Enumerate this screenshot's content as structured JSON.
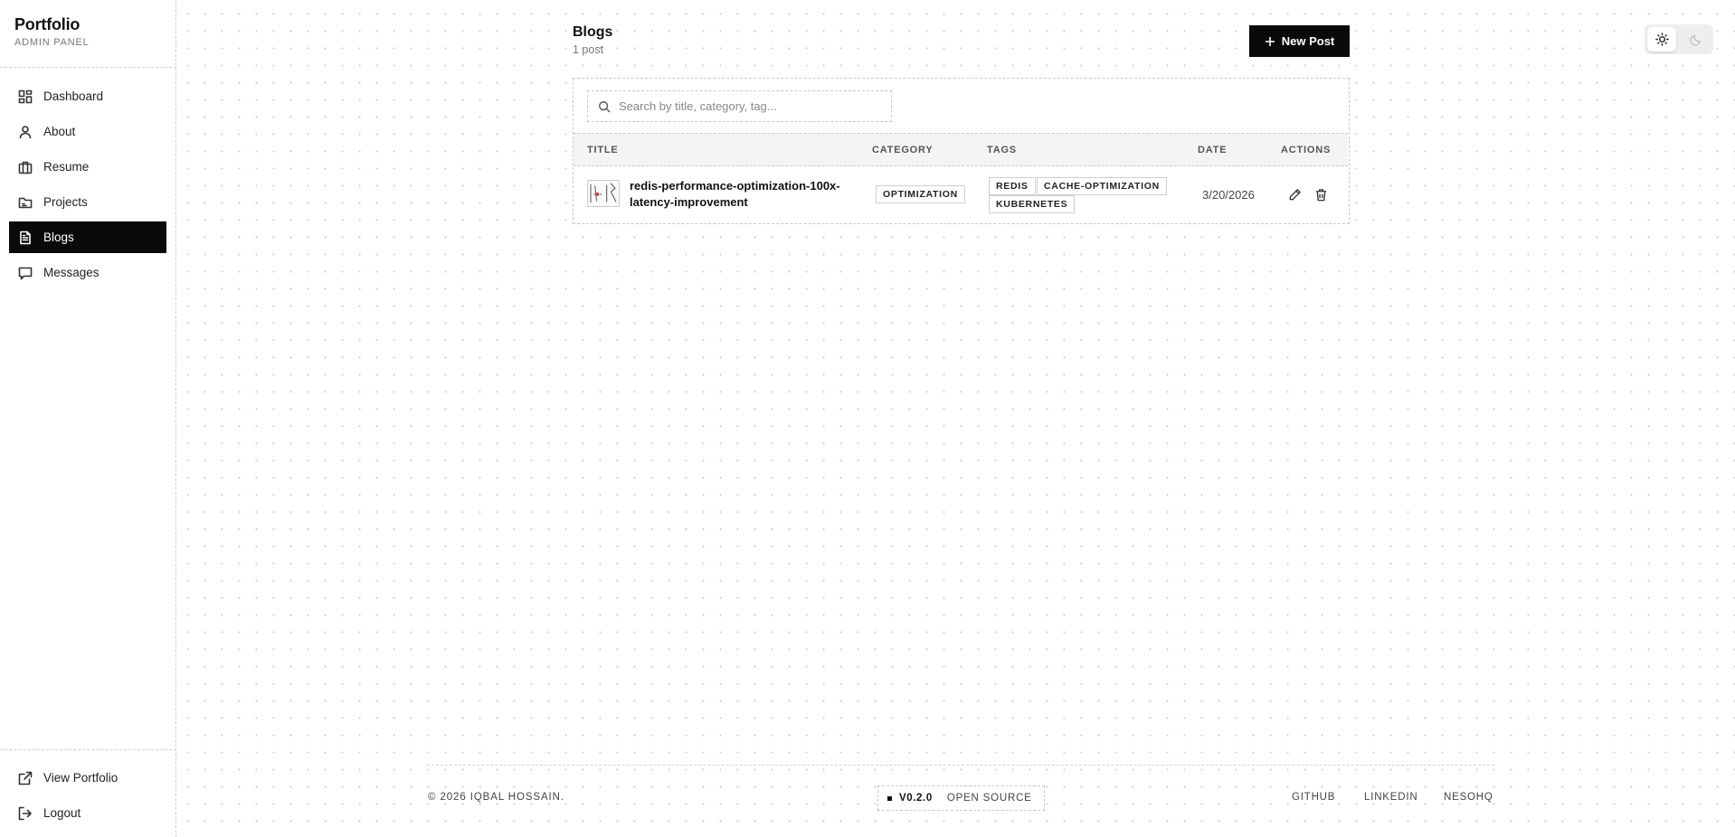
{
  "brand": {
    "title": "Portfolio",
    "subtitle": "ADMIN PANEL"
  },
  "sidebar": {
    "items": [
      {
        "label": "Dashboard",
        "icon": "dashboard-icon"
      },
      {
        "label": "About",
        "icon": "user-icon"
      },
      {
        "label": "Resume",
        "icon": "briefcase-icon"
      },
      {
        "label": "Projects",
        "icon": "folder-icon"
      },
      {
        "label": "Blogs",
        "icon": "document-icon",
        "active": true
      },
      {
        "label": "Messages",
        "icon": "message-icon"
      }
    ],
    "bottom": [
      {
        "label": "View Portfolio",
        "icon": "external-link-icon"
      },
      {
        "label": "Logout",
        "icon": "logout-icon"
      }
    ]
  },
  "header": {
    "title": "Blogs",
    "count": "1 post",
    "new_post_label": "New Post"
  },
  "theme": {
    "mode": "light"
  },
  "search": {
    "placeholder": "Search by title, category, tag..."
  },
  "table": {
    "columns": [
      "TITLE",
      "CATEGORY",
      "TAGS",
      "DATE",
      "ACTIONS"
    ],
    "rows": [
      {
        "title": "redis-performance-optimization-100x-latency-improvement",
        "category": "OPTIMIZATION",
        "tags": [
          "REDIS",
          "CACHE-OPTIMIZATION",
          "KUBERNETES"
        ],
        "date": "3/20/2026"
      }
    ]
  },
  "footer": {
    "copyright": "© 2026 IQBAL HOSSAIN.",
    "version": "V0.2.0",
    "open_source": "OPEN SOURCE",
    "links": [
      "GITHUB",
      "LINKEDIN",
      "NESOHQ"
    ]
  },
  "colors": {
    "accent": "#0a0a0a",
    "border": "#c8c8c8",
    "header_bg": "#f4f4f4"
  }
}
